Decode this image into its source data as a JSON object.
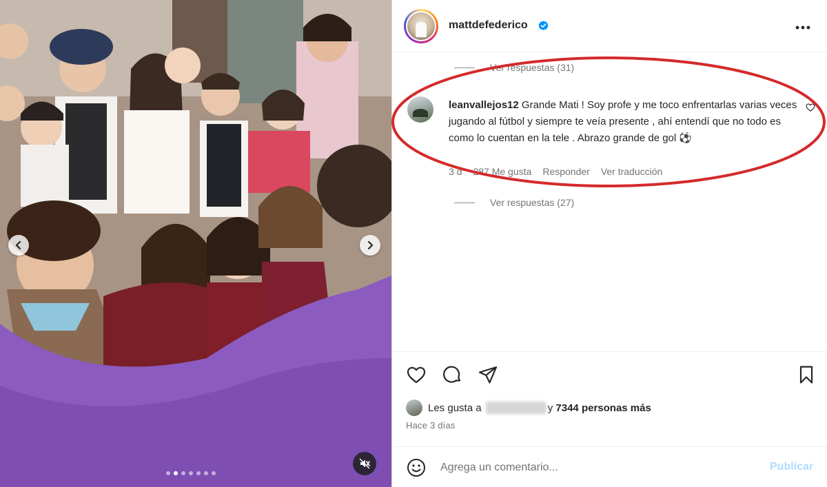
{
  "post": {
    "username": "mattdefederico",
    "verified": true,
    "media": {
      "carousel_dots": 7,
      "active_dot": 2
    }
  },
  "comments_panel": {
    "replies_top": "Ver respuestas (31)",
    "comment": {
      "username": "leanvallejos12",
      "text": "Grande Mati ! Soy profe y me toco enfrentarlas varias veces jugando al fútbol y siempre te veía presente , ahí entendí que no todo es como lo cuentan en la tele . Abrazo grande de gol ⚽",
      "time": "3 d",
      "likes": "287 Me gusta",
      "reply": "Responder",
      "translate": "Ver traducción"
    },
    "replies_bottom": "Ver respuestas (27)"
  },
  "likes": {
    "prefix": "Les gusta a",
    "connector": "y",
    "count_text": "7344 personas más"
  },
  "posted_time": "Hace 3 días",
  "comment_box": {
    "placeholder": "Agrega un comentario...",
    "publish_label": "Publicar"
  },
  "colors": {
    "annotation_oval": "#d42a2a",
    "verified_badge": "#0095f6",
    "publish_disabled": "#b3dbff"
  },
  "icons": [
    "chevron-left-icon",
    "chevron-right-icon",
    "mute-icon",
    "more-icon",
    "heart-icon",
    "comment-icon",
    "share-icon",
    "bookmark-icon",
    "emoji-icon",
    "verified-icon"
  ]
}
